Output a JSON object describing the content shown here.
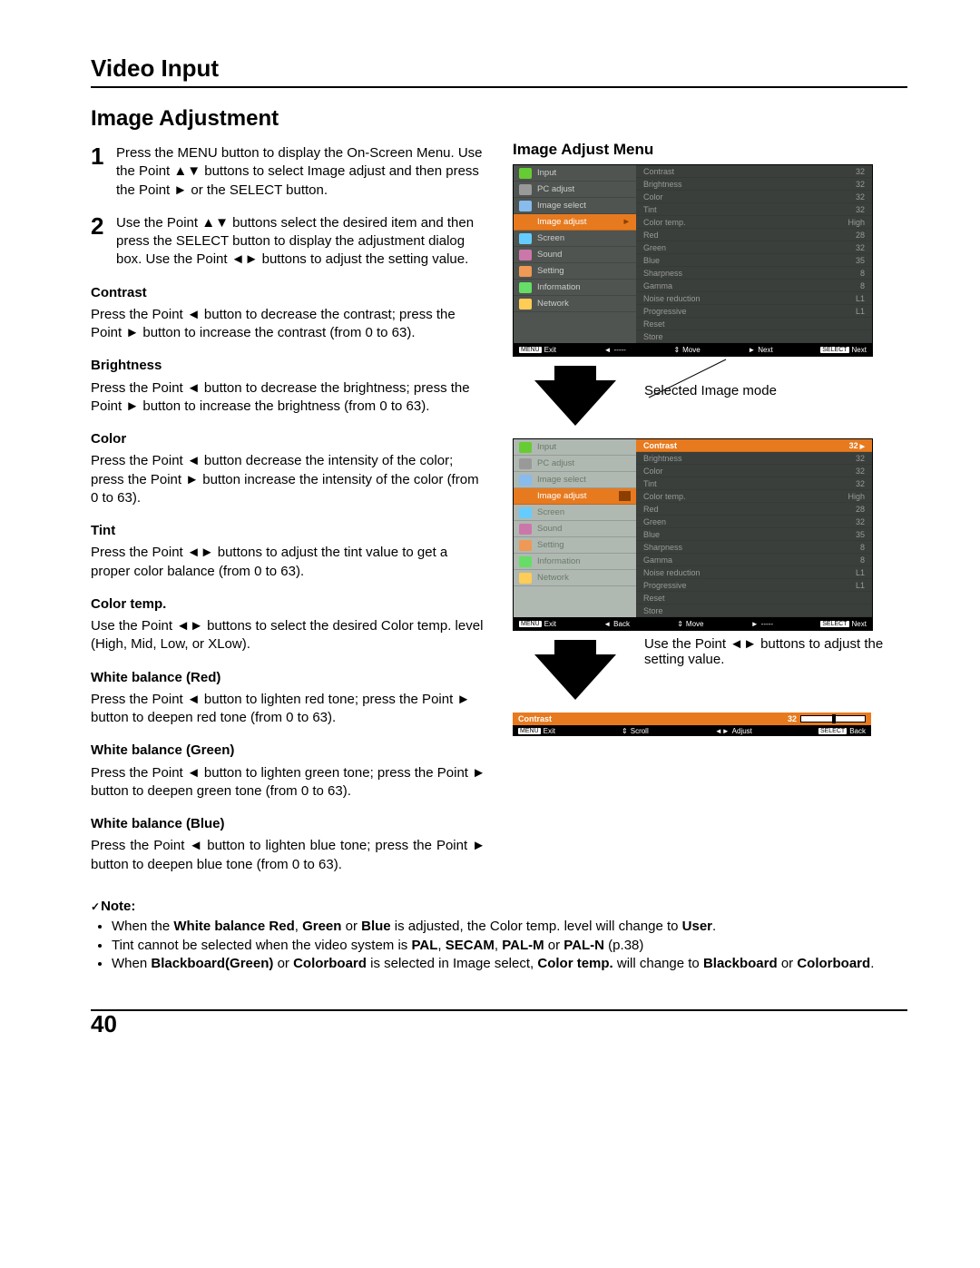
{
  "header": {
    "section": "Video Input",
    "title": "Image Adjustment",
    "pageNumber": "40"
  },
  "steps": {
    "s1num": "1",
    "s1": "Press the MENU button to display the On-Screen Menu. Use the Point ▲▼ buttons to select Image adjust and then press the Point ► or the SELECT button.",
    "s2num": "2",
    "s2": "Use the Point ▲▼ buttons select the desired item and then press the SELECT button to display the adjustment dialog box. Use the Point ◄► buttons to adjust the setting value."
  },
  "params": {
    "contrast_h": "Contrast",
    "contrast_p": "Press the Point ◄ button to decrease the contrast; press the Point ► button to increase the contrast (from 0 to 63).",
    "brightness_h": "Brightness",
    "brightness_p": "Press the Point ◄ button to decrease the brightness; press the Point ► button to increase the brightness (from 0 to 63).",
    "color_h": "Color",
    "color_p": "Press the Point ◄ button decrease the intensity of the color; press the Point ► button increase the intensity of the color (from 0 to 63).",
    "tint_h": "Tint",
    "tint_p": "Press the Point ◄► buttons to adjust the tint value to get a proper color balance (from 0 to 63).",
    "ctemp_h": "Color temp.",
    "ctemp_p": "Use the Point ◄► buttons to select the desired Color temp. level (High, Mid, Low, or XLow).",
    "wbr_h": "White balance (Red)",
    "wbr_p": "Press the Point ◄ button to lighten red tone; press the Point ► button to deepen red tone (from 0 to 63).",
    "wbg_h": "White balance (Green)",
    "wbg_p": "Press the Point ◄ button to lighten green tone; press the Point ► button to deepen green tone (from 0 to 63).",
    "wbb_h": "White balance (Blue)",
    "wbb_p": "Press the Point ◄ button to lighten blue tone; press the Point ► button to deepen blue tone (from 0 to 63).",
    "note_h": "Note:"
  },
  "notes": {
    "n1a": "When the ",
    "n1b": "White balance Red",
    "n1c": ", ",
    "n1d": "Green",
    "n1e": " or ",
    "n1f": "Blue",
    "n1g": " is adjusted, the Color temp. level will change to ",
    "n1h": "User",
    "n1i": ".",
    "n2a": "Tint cannot be selected when the video system is ",
    "n2b": "PAL",
    "n2c": ", ",
    "n2d": "SECAM",
    "n2e": ", ",
    "n2f": "PAL-M",
    "n2g": " or ",
    "n2h": "PAL-N",
    "n2i": " (p.38)",
    "n3a": "When ",
    "n3b": "Blackboard(Green)",
    "n3c": " or ",
    "n3d": "Colorboard",
    "n3e": " is selected in Image select, ",
    "n3f": "Color temp.",
    "n3g": " will change to ",
    "n3h": "Blackboard",
    "n3i": " or ",
    "n3j": "Colorboard",
    "n3k": "."
  },
  "right": {
    "title": "Image Adjust Menu",
    "selected_label": "Selected Image mode",
    "tip": "Use the Point ◄► buttons to adjust the setting value."
  },
  "menu": {
    "left_items": [
      "Input",
      "PC adjust",
      "Image select",
      "Image adjust",
      "Screen",
      "Sound",
      "Setting",
      "Information",
      "Network"
    ],
    "left_colors": [
      "#6c3",
      "#999",
      "#8be",
      "#e77a1f",
      "#6cf",
      "#c7a",
      "#e95",
      "#6d6",
      "#fc5"
    ],
    "right_items": [
      {
        "l": "Contrast",
        "v": "32"
      },
      {
        "l": "Brightness",
        "v": "32"
      },
      {
        "l": "Color",
        "v": "32"
      },
      {
        "l": "Tint",
        "v": "32"
      },
      {
        "l": "Color temp.",
        "v": "High"
      },
      {
        "l": "Red",
        "v": "28"
      },
      {
        "l": "Green",
        "v": "32"
      },
      {
        "l": "Blue",
        "v": "35"
      },
      {
        "l": "Sharpness",
        "v": "8"
      },
      {
        "l": "Gamma",
        "v": "8"
      },
      {
        "l": "Noise reduction",
        "v": "L1"
      },
      {
        "l": "Progressive",
        "v": "L1"
      },
      {
        "l": "Reset",
        "v": ""
      },
      {
        "l": "Store",
        "v": ""
      }
    ],
    "footer1": {
      "exit": "Exit",
      "back": "-----",
      "move": "Move",
      "next": "Next",
      "sel": "Next"
    },
    "footer2": {
      "exit": "Exit",
      "back": "Back",
      "move": "Move",
      "next": "-----",
      "sel": "Next"
    },
    "ctrl": {
      "label": "Contrast",
      "val": "32"
    },
    "ctrl_footer": {
      "exit": "Exit",
      "scroll": "Scroll",
      "adjust": "Adjust",
      "back": "Back"
    },
    "menu_label": "MENU",
    "select_label": "SELECT",
    "arrow_back": "◄",
    "arrow_move": "⇕",
    "arrow_next": "►"
  }
}
